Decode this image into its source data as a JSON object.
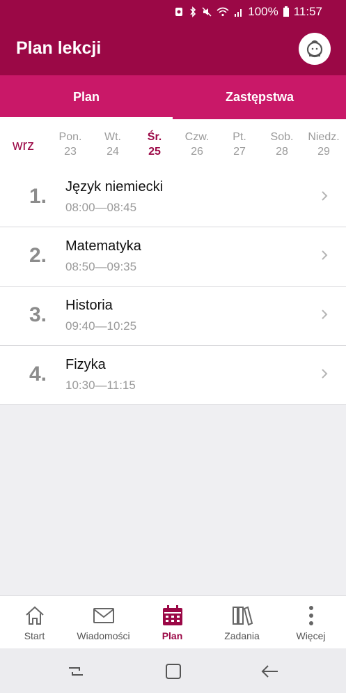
{
  "status": {
    "battery": "100%",
    "time": "11:57"
  },
  "app": {
    "title": "Plan lekcji"
  },
  "tabs": [
    {
      "label": "Plan",
      "active": true
    },
    {
      "label": "Zastępstwa",
      "active": false
    }
  ],
  "days": {
    "month": "wrz",
    "items": [
      {
        "name": "Pon.",
        "num": "23",
        "active": false
      },
      {
        "name": "Wt.",
        "num": "24",
        "active": false
      },
      {
        "name": "Śr.",
        "num": "25",
        "active": true
      },
      {
        "name": "Czw.",
        "num": "26",
        "active": false
      },
      {
        "name": "Pt.",
        "num": "27",
        "active": false
      },
      {
        "name": "Sob.",
        "num": "28",
        "active": false
      },
      {
        "name": "Niedz.",
        "num": "29",
        "active": false
      }
    ]
  },
  "lessons": [
    {
      "num": "1.",
      "subject": "Język niemiecki",
      "time": "08:00—08:45"
    },
    {
      "num": "2.",
      "subject": "Matematyka",
      "time": "08:50—09:35"
    },
    {
      "num": "3.",
      "subject": "Historia",
      "time": "09:40—10:25"
    },
    {
      "num": "4.",
      "subject": "Fizyka",
      "time": "10:30—11:15"
    }
  ],
  "nav": [
    {
      "label": "Start",
      "icon": "home-icon",
      "active": false
    },
    {
      "label": "Wiadomości",
      "icon": "mail-icon",
      "active": false
    },
    {
      "label": "Plan",
      "icon": "calendar-icon",
      "active": true
    },
    {
      "label": "Zadania",
      "icon": "books-icon",
      "active": false
    },
    {
      "label": "Więcej",
      "icon": "more-vertical-icon",
      "active": false
    }
  ],
  "colors": {
    "primary": "#9b0846",
    "accent": "#c91868"
  }
}
